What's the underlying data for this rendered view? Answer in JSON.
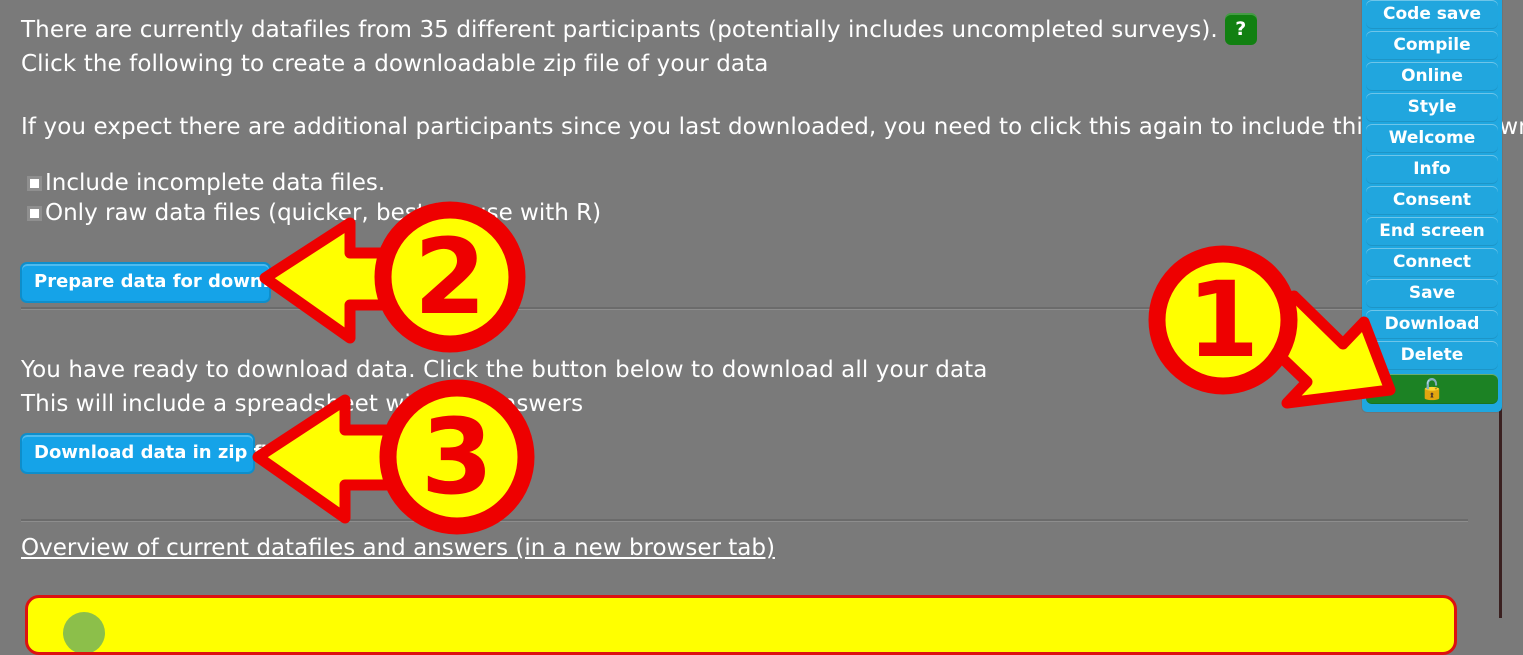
{
  "main": {
    "intro_line1": "There are currently datafiles from 35 different participants (potentially includes uncompleted surveys).",
    "help_badge": "?",
    "intro_line2": "Click the following to create a downloadable zip file of your data",
    "intro_line3": "If you expect there are additional participants since you last downloaded, you need to click this again to include this in your download.",
    "checkbox_include_incomplete": "Include incomplete data files.",
    "checkbox_only_raw": "Only raw data files (quicker, best for use with R)",
    "prepare_button": "Prepare data for download",
    "ready_line1": "You have ready to download data. Click the button below to download all your data",
    "ready_line2": "This will include a spreadsheet with the answers",
    "download_button": "Download data in zip file",
    "overview_link": "Overview of current datafiles and answers (in a new browser tab)"
  },
  "sidebar": {
    "items": [
      {
        "label": "Code save",
        "name": "code-save"
      },
      {
        "label": "Compile",
        "name": "compile"
      },
      {
        "label": "Online",
        "name": "online"
      },
      {
        "label": "Style",
        "name": "style"
      },
      {
        "label": "Welcome",
        "name": "welcome"
      },
      {
        "label": "Info",
        "name": "info"
      },
      {
        "label": "Consent",
        "name": "consent"
      },
      {
        "label": "End screen",
        "name": "end-screen"
      },
      {
        "label": "Connect",
        "name": "connect"
      },
      {
        "label": "Save",
        "name": "save"
      },
      {
        "label": "Download",
        "name": "download"
      },
      {
        "label": "Delete",
        "name": "delete"
      }
    ],
    "lock_button": "🔓"
  },
  "annotations": {
    "step1": "1",
    "step2": "2",
    "step3": "3"
  },
  "colors": {
    "page_background": "#7a7a7a",
    "button_blue": "#15a3e8",
    "sidebar_blue": "#21a6de",
    "help_green": "#118011",
    "lock_green": "#1c8224",
    "annotation_red": "#ee0000",
    "annotation_yellow": "#ffff00",
    "alert_yellow": "#ffff00"
  }
}
